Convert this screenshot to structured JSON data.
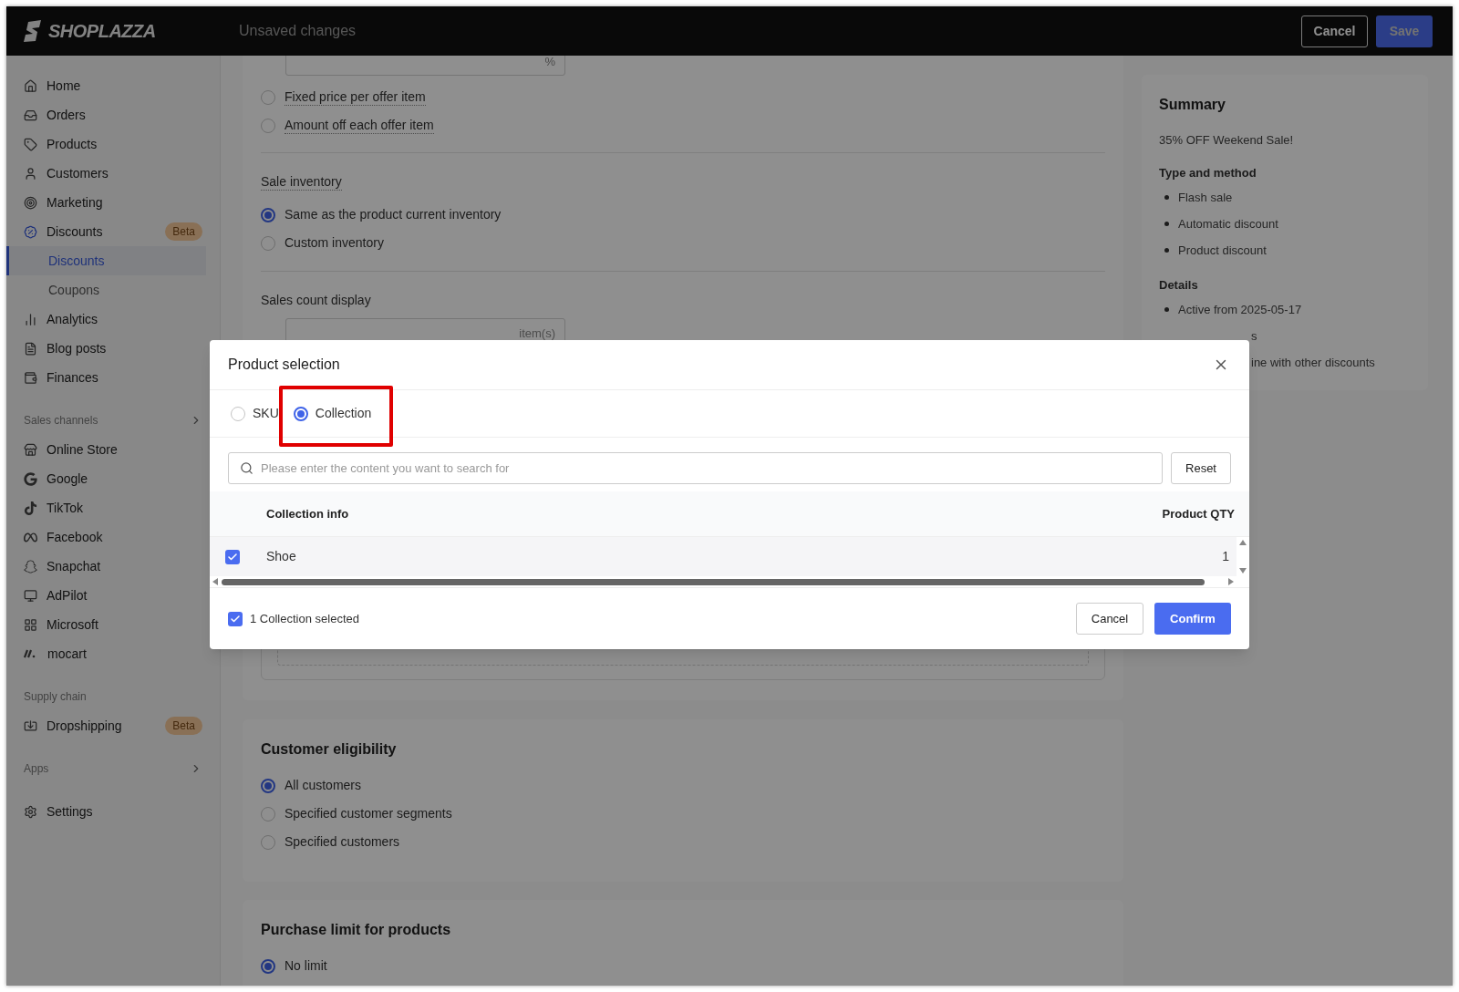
{
  "header": {
    "logo": "SHOPLAZZA",
    "title": "Unsaved changes",
    "cancel": "Cancel",
    "save": "Save"
  },
  "sidebar": [
    {
      "kind": "item",
      "label": "Home"
    },
    {
      "kind": "item",
      "label": "Orders"
    },
    {
      "kind": "item",
      "label": "Products"
    },
    {
      "kind": "item",
      "label": "Customers"
    },
    {
      "kind": "item",
      "label": "Marketing"
    },
    {
      "kind": "item",
      "label": "Discounts",
      "badge": "Beta"
    },
    {
      "kind": "subitem",
      "label": "Discounts",
      "selected": true
    },
    {
      "kind": "subitem",
      "label": "Coupons",
      "selected": false
    },
    {
      "kind": "item",
      "label": "Analytics"
    },
    {
      "kind": "item",
      "label": "Blog posts"
    },
    {
      "kind": "item",
      "label": "Finances"
    },
    {
      "kind": "heading",
      "label": "Sales channels",
      "expandable": true
    },
    {
      "kind": "item",
      "label": "Online Store"
    },
    {
      "kind": "item",
      "label": "Google"
    },
    {
      "kind": "item",
      "label": "TikTok"
    },
    {
      "kind": "item",
      "label": "Facebook"
    },
    {
      "kind": "item",
      "label": "Snapchat"
    },
    {
      "kind": "item",
      "label": "AdPilot"
    },
    {
      "kind": "item",
      "label": "Microsoft"
    },
    {
      "kind": "item",
      "label": "mocart"
    },
    {
      "kind": "heading",
      "label": "Supply chain"
    },
    {
      "kind": "item",
      "label": "Dropshipping",
      "badge": "Beta"
    },
    {
      "kind": "heading",
      "label": "Apps",
      "expandable": true
    },
    {
      "kind": "item",
      "label": "Settings"
    }
  ],
  "offer": {
    "value_suffix": "%",
    "options": [
      {
        "label": "Fixed price per offer item",
        "selected": false
      },
      {
        "label": "Amount off each offer item",
        "selected": false
      }
    ]
  },
  "sale_inventory": {
    "label": "Sale inventory",
    "options": [
      {
        "label": "Same as the product current inventory",
        "selected": true
      },
      {
        "label": "Custom inventory",
        "selected": false
      }
    ]
  },
  "sales_count_display": {
    "label": "Sales count display",
    "suffix": "item(s)"
  },
  "customer_eligibility": {
    "title": "Customer eligibility",
    "options": [
      {
        "label": "All customers",
        "selected": true
      },
      {
        "label": "Specified customer segments",
        "selected": false
      },
      {
        "label": "Specified customers",
        "selected": false
      }
    ]
  },
  "purchase_limit": {
    "title": "Purchase limit for products",
    "options": [
      {
        "label": "No limit",
        "selected": true
      }
    ]
  },
  "summary": {
    "title": "Summary",
    "name": "35% OFF Weekend Sale!",
    "sections": [
      {
        "title": "Type and method",
        "items": [
          "Flash sale",
          "Automatic discount",
          "Product discount"
        ]
      },
      {
        "title": "Details",
        "items": [
          "Active from 2025-05-17"
        ]
      }
    ],
    "covered_lines": [
      "s",
      "ine with other discounts"
    ]
  },
  "modal": {
    "title": "Product selection",
    "types": [
      {
        "label": "SKU",
        "selected": false
      },
      {
        "label": "Collection",
        "selected": true,
        "highlighted": true
      }
    ],
    "search": {
      "placeholder": "Please enter the content you want to search for"
    },
    "reset": "Reset",
    "columns": [
      "Collection info",
      "Product QTY"
    ],
    "rows": [
      {
        "name": "Shoe",
        "qty": "1",
        "checked": true
      }
    ],
    "footer": {
      "checked": true,
      "text": "1 Collection selected"
    },
    "cancel": "Cancel",
    "confirm": "Confirm"
  }
}
